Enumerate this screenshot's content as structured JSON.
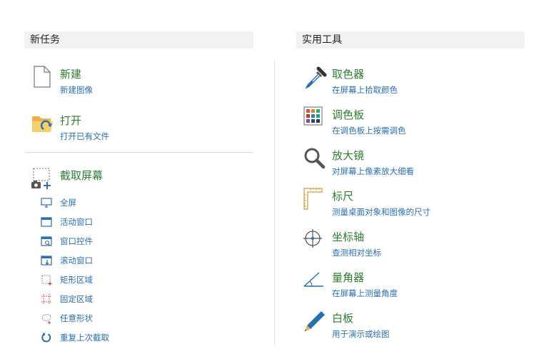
{
  "left_header": "新任务",
  "right_header": "实用工具",
  "new_tasks": [
    {
      "title": "新建",
      "desc": "新建图像",
      "icon": "new-file-icon"
    },
    {
      "title": "打开",
      "desc": "打开已有文件",
      "icon": "open-folder-icon"
    }
  ],
  "capture": {
    "title": "截取屏幕",
    "icon": "screen-capture-icon",
    "items": [
      {
        "label": "全屏",
        "icon": "monitor-icon"
      },
      {
        "label": "活动窗口",
        "icon": "window-icon"
      },
      {
        "label": "窗口控件",
        "icon": "window-control-icon"
      },
      {
        "label": "滚动窗口",
        "icon": "scroll-window-icon"
      },
      {
        "label": "矩形区域",
        "icon": "rectangle-region-icon"
      },
      {
        "label": "固定区域",
        "icon": "fixed-region-icon"
      },
      {
        "label": "任意形状",
        "icon": "freeform-icon"
      },
      {
        "label": "重复上次截取",
        "icon": "repeat-icon"
      }
    ]
  },
  "tools": [
    {
      "title": "取色器",
      "desc": "在屏幕上拾取颜色",
      "icon": "eyedropper-icon"
    },
    {
      "title": "调色板",
      "desc": "在调色板上按需调色",
      "icon": "palette-icon"
    },
    {
      "title": "放大镜",
      "desc": "对屏幕上像素放大细看",
      "icon": "magnifier-icon"
    },
    {
      "title": "标尺",
      "desc": "测量桌面对象和图像的尺寸",
      "icon": "ruler-icon"
    },
    {
      "title": "坐标轴",
      "desc": "查测相对坐标",
      "icon": "crosshair-icon"
    },
    {
      "title": "量角器",
      "desc": "在屏幕上测量角度",
      "icon": "protractor-icon"
    },
    {
      "title": "白板",
      "desc": "用于演示或绘图",
      "icon": "pen-icon"
    }
  ],
  "colors": {
    "title_green": "#2e7d32",
    "link_blue": "#2a6fb0"
  }
}
